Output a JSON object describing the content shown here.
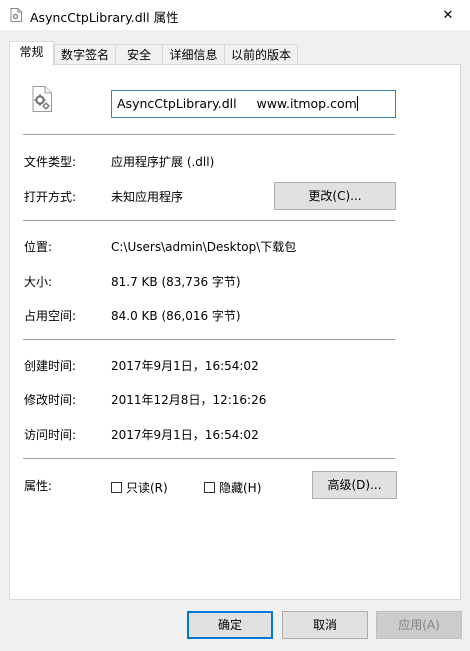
{
  "window": {
    "title": "AsyncCtpLibrary.dll 属性",
    "close_symbol": "✕"
  },
  "tabs": [
    {
      "label": "常规"
    },
    {
      "label": "数字签名"
    },
    {
      "label": "安全"
    },
    {
      "label": "详细信息"
    },
    {
      "label": "以前的版本"
    }
  ],
  "general": {
    "file_name_value": "AsyncCtpLibrary.dll     www.itmop.com",
    "rows": {
      "file_type": {
        "label": "文件类型:",
        "value": "应用程序扩展 (.dll)"
      },
      "open_with": {
        "label": "打开方式:",
        "value": "未知应用程序"
      },
      "location": {
        "label": "位置:",
        "value": "C:\\Users\\admin\\Desktop\\下载包"
      },
      "size": {
        "label": "大小:",
        "value": "81.7 KB (83,736 字节)"
      },
      "size_on_disk": {
        "label": "占用空间:",
        "value": "84.0 KB (86,016 字节)"
      },
      "created": {
        "label": "创建时间:",
        "value": "2017年9月1日，16:54:02"
      },
      "modified": {
        "label": "修改时间:",
        "value": "2011年12月8日，12:16:26"
      },
      "accessed": {
        "label": "访问时间:",
        "value": "2017年9月1日，16:54:02"
      }
    },
    "change_button": "更改(C)...",
    "attributes_label": "属性:",
    "readonly_label": "只读(R)",
    "readonly_checked": false,
    "hidden_label": "隐藏(H)",
    "hidden_checked": false,
    "advanced_button": "高级(D)..."
  },
  "footer": {
    "ok": "确定",
    "cancel": "取消",
    "apply": "应用(A)"
  },
  "colors": {
    "accent": "#0078d7",
    "input_border": "#3c7fb1"
  },
  "icons": {
    "title": "dll-file-icon",
    "file": "dll-file-gear-icon",
    "close": "close-icon"
  }
}
